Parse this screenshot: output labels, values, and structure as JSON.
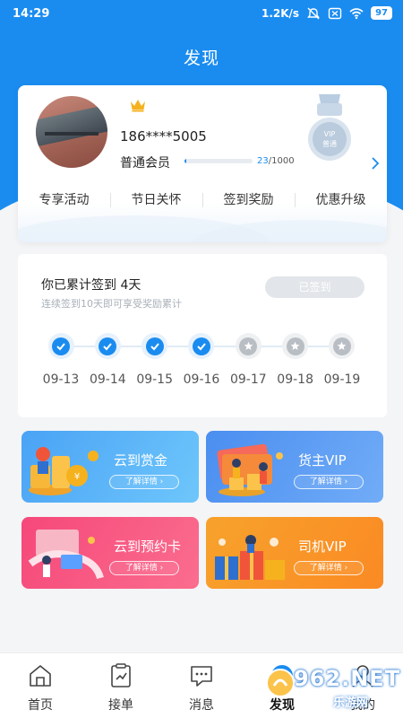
{
  "status_bar": {
    "time": "14:29",
    "network_speed": "1.2K/s",
    "battery": "97"
  },
  "page": {
    "title": "发现"
  },
  "user": {
    "phone": "186****5005",
    "level": "普通会员",
    "progress_current": "23",
    "progress_total": "/1000",
    "progress_fraction": 0.023,
    "vip_badge_text": "VIP\n普通"
  },
  "quick_links": [
    "专享活动",
    "节日关怀",
    "签到奖励",
    "优惠升级"
  ],
  "signin": {
    "title": "你已累计签到 4天",
    "subtitle": "连续签到10天即可享受奖励累计",
    "button": "已签到",
    "days": [
      {
        "date": "09-13",
        "done": true
      },
      {
        "date": "09-14",
        "done": true
      },
      {
        "date": "09-15",
        "done": true
      },
      {
        "date": "09-16",
        "done": true
      },
      {
        "date": "09-17",
        "done": false
      },
      {
        "date": "09-18",
        "done": false
      },
      {
        "date": "09-19",
        "done": false
      }
    ]
  },
  "tiles": [
    {
      "title": "云到赏金",
      "button": "了解详情 ›",
      "color_from": "#4aa3f5",
      "color_to": "#6ec6fb"
    },
    {
      "title": "货主VIP",
      "button": "了解详情 ›",
      "color_from": "#4a8ef0",
      "color_to": "#71acf7"
    },
    {
      "title": "云到预约卡",
      "button": "了解详情 ›",
      "color_from": "#f5487a",
      "color_to": "#fb6d8e"
    },
    {
      "title": "司机VIP",
      "button": "了解详情 ›",
      "color_from": "#f7a22c",
      "color_to": "#fb8a24"
    }
  ],
  "tabbar": {
    "items": [
      {
        "label": "首页",
        "icon": "home-icon"
      },
      {
        "label": "接单",
        "icon": "order-icon"
      },
      {
        "label": "消息",
        "icon": "message-icon"
      },
      {
        "label": "发现",
        "icon": "discover-icon"
      },
      {
        "label": "我的",
        "icon": "profile-icon"
      }
    ]
  },
  "watermark": {
    "text": "962.NET",
    "sub": "乐游网"
  },
  "colors": {
    "primary": "#1a8cf0",
    "background": "#f4f5f7"
  }
}
